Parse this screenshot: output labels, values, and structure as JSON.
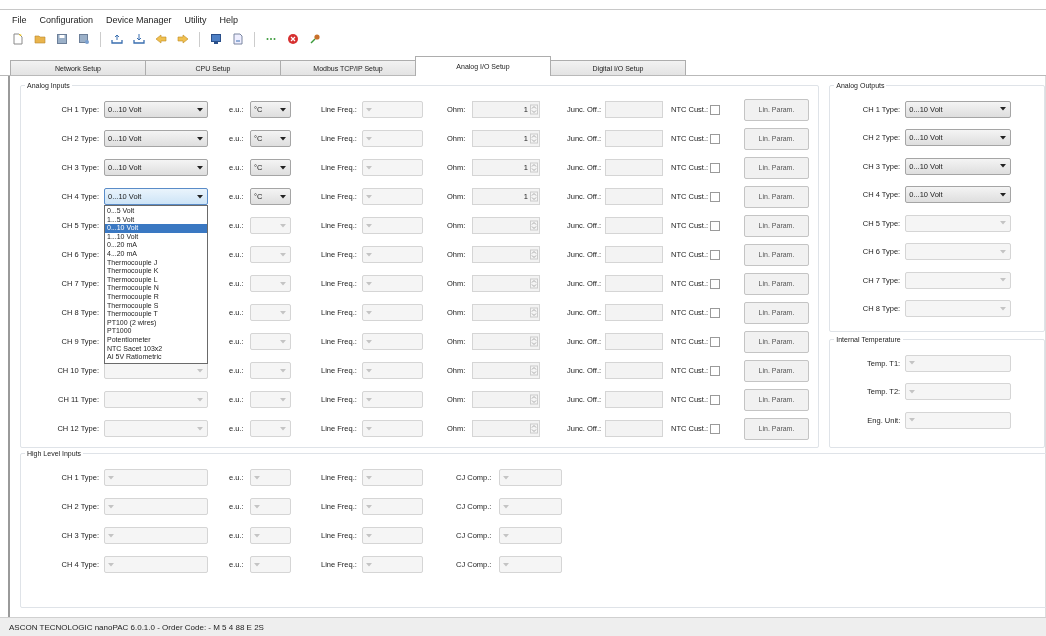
{
  "menu": [
    "File",
    "Configuration",
    "Device Manager",
    "Utility",
    "Help"
  ],
  "tabs": [
    {
      "label": "Network Setup",
      "selected": false
    },
    {
      "label": "CPU Setup",
      "selected": false
    },
    {
      "label": "Modbus TCP/IP Setup",
      "selected": false
    },
    {
      "label": "Analog I/O Setup",
      "selected": true
    },
    {
      "label": "Digital I/O Setup",
      "selected": false
    }
  ],
  "analog_inputs": {
    "title": "Analog Inputs",
    "rows": [
      {
        "label": "CH 1 Type:",
        "type": "0...10 Volt",
        "eu_label": "e.u.:",
        "eu": "°C",
        "freq_label": "Line Freq.:",
        "ohm_label": "Ohm:",
        "ohm": "1",
        "junc_label": "Junc. Off.:",
        "ntc_label": "NTC Cust.:",
        "ntc_checked": false,
        "button": "Lin. Param.",
        "enabled": true,
        "expanded": false
      },
      {
        "label": "CH 2 Type:",
        "type": "0...10 Volt",
        "eu_label": "e.u.:",
        "eu": "°C",
        "freq_label": "Line Freq.:",
        "ohm_label": "Ohm:",
        "ohm": "1",
        "junc_label": "Junc. Off.:",
        "ntc_label": "NTC Cust.:",
        "ntc_checked": false,
        "button": "Lin. Param.",
        "enabled": true,
        "expanded": false
      },
      {
        "label": "CH 3 Type:",
        "type": "0...10 Volt",
        "eu_label": "e.u.:",
        "eu": "°C",
        "freq_label": "Line Freq.:",
        "ohm_label": "Ohm:",
        "ohm": "1",
        "junc_label": "Junc. Off.:",
        "ntc_label": "NTC Cust.:",
        "ntc_checked": false,
        "button": "Lin. Param.",
        "enabled": true,
        "expanded": false
      },
      {
        "label": "CH 4 Type:",
        "type": "0...10 Volt",
        "eu_label": "e.u.:",
        "eu": "°C",
        "freq_label": "Line Freq.:",
        "ohm_label": "Ohm:",
        "ohm": "1",
        "junc_label": "Junc. Off.:",
        "ntc_label": "NTC Cust.:",
        "ntc_checked": false,
        "button": "Lin. Param.",
        "enabled": true,
        "expanded": true,
        "options": [
          {
            "label": "0...5 Volt",
            "selected": false
          },
          {
            "label": "1...5 Volt",
            "selected": false
          },
          {
            "label": "0...10 Volt",
            "selected": true
          },
          {
            "label": "1...10 Volt",
            "selected": false
          },
          {
            "label": "0...20 mA",
            "selected": false
          },
          {
            "label": "4...20 mA",
            "selected": false
          },
          {
            "label": "Thermocouple J",
            "selected": false
          },
          {
            "label": "Thermocouple K",
            "selected": false
          },
          {
            "label": "Thermocouple L",
            "selected": false
          },
          {
            "label": "Thermocouple N",
            "selected": false
          },
          {
            "label": "Thermocouple R",
            "selected": false
          },
          {
            "label": "Thermocouple S",
            "selected": false
          },
          {
            "label": "Thermocouple T",
            "selected": false
          },
          {
            "label": "PT100 (2 wires)",
            "selected": false
          },
          {
            "label": "PT1000",
            "selected": false
          },
          {
            "label": "Potentiometer",
            "selected": false
          },
          {
            "label": "NTC Sacet 103x2",
            "selected": false
          },
          {
            "label": "AI 5V Ratiometric",
            "selected": false
          }
        ]
      },
      {
        "label": "CH 5 Type:",
        "eu_label": "e.u.:",
        "freq_label": "Line Freq.:",
        "ohm_label": "Ohm:",
        "junc_label": "Junc. Off.:",
        "ntc_label": "NTC Cust.:",
        "ntc_checked": false,
        "button": "Lin. Param.",
        "enabled": false,
        "expanded": false
      },
      {
        "label": "CH 6 Type:",
        "eu_label": "e.u.:",
        "freq_label": "Line Freq.:",
        "ohm_label": "Ohm:",
        "junc_label": "Junc. Off.:",
        "ntc_label": "NTC Cust.:",
        "ntc_checked": false,
        "button": "Lin. Param.",
        "enabled": false,
        "expanded": false
      },
      {
        "label": "CH 7 Type:",
        "eu_label": "e.u.:",
        "freq_label": "Line Freq.:",
        "ohm_label": "Ohm:",
        "junc_label": "Junc. Off.:",
        "ntc_label": "NTC Cust.:",
        "ntc_checked": false,
        "button": "Lin. Param.",
        "enabled": false,
        "expanded": false
      },
      {
        "label": "CH 8 Type:",
        "eu_label": "e.u.:",
        "freq_label": "Line Freq.:",
        "ohm_label": "Ohm:",
        "junc_label": "Junc. Off.:",
        "ntc_label": "NTC Cust.:",
        "ntc_checked": false,
        "button": "Lin. Param.",
        "enabled": false,
        "expanded": false
      },
      {
        "label": "CH 9 Type:",
        "eu_label": "e.u.:",
        "freq_label": "Line Freq.:",
        "ohm_label": "Ohm:",
        "junc_label": "Junc. Off.:",
        "ntc_label": "NTC Cust.:",
        "ntc_checked": false,
        "button": "Lin. Param.",
        "enabled": false,
        "expanded": false
      },
      {
        "label": "CH 10 Type:",
        "eu_label": "e.u.:",
        "freq_label": "Line Freq.:",
        "ohm_label": "Ohm:",
        "junc_label": "Junc. Off.:",
        "ntc_label": "NTC Cust.:",
        "ntc_checked": false,
        "button": "Lin. Param.",
        "enabled": false,
        "expanded": false
      },
      {
        "label": "CH 11 Type:",
        "eu_label": "e.u.:",
        "freq_label": "Line Freq.:",
        "ohm_label": "Ohm:",
        "junc_label": "Junc. Off.:",
        "ntc_label": "NTC Cust.:",
        "ntc_checked": false,
        "button": "Lin. Param.",
        "enabled": false,
        "expanded": false
      },
      {
        "label": "CH 12 Type:",
        "eu_label": "e.u.:",
        "freq_label": "Line Freq.:",
        "ohm_label": "Ohm:",
        "junc_label": "Junc. Off.:",
        "ntc_label": "NTC Cust.:",
        "ntc_checked": false,
        "button": "Lin. Param.",
        "enabled": false,
        "expanded": false
      }
    ]
  },
  "analog_outputs": {
    "title": "Analog Outputs",
    "rows": [
      {
        "label": "CH 1 Type:",
        "type": "0...10 Volt",
        "enabled": true
      },
      {
        "label": "CH 2 Type:",
        "type": "0...10 Volt",
        "enabled": true
      },
      {
        "label": "CH 3 Type:",
        "type": "0...10 Volt",
        "enabled": true
      },
      {
        "label": "CH 4 Type:",
        "type": "0...10 Volt",
        "enabled": true
      },
      {
        "label": "CH 5 Type:",
        "enabled": false
      },
      {
        "label": "CH 6 Type:",
        "enabled": false
      },
      {
        "label": "CH 7 Type:",
        "enabled": false
      },
      {
        "label": "CH 8 Type:",
        "enabled": false
      }
    ]
  },
  "internal_temperature": {
    "title": "Internal Temperature",
    "rows": [
      {
        "label": "Temp. T1:",
        "enabled": false
      },
      {
        "label": "Temp. T2:",
        "enabled": false
      },
      {
        "label": "Eng. Unit:",
        "enabled": false
      }
    ]
  },
  "high_level_inputs": {
    "title": "High Level Inputs",
    "rows": [
      {
        "label": "CH 1 Type:",
        "eu_label": "e.u.:",
        "freq_label": "Line Freq.:",
        "cj_label": "CJ Comp.:",
        "enabled": false
      },
      {
        "label": "CH 2 Type:",
        "eu_label": "e.u.:",
        "freq_label": "Line Freq.:",
        "cj_label": "CJ Comp.:",
        "enabled": false
      },
      {
        "label": "CH 3 Type:",
        "eu_label": "e.u.:",
        "freq_label": "Line Freq.:",
        "cj_label": "CJ Comp.:",
        "enabled": false
      },
      {
        "label": "CH 4 Type:",
        "eu_label": "e.u.:",
        "freq_label": "Line Freq.:",
        "cj_label": "CJ Comp.:",
        "enabled": false
      }
    ]
  },
  "status_bar": "ASCON TECNOLOGIC nanoPAC 6.0.1.0 - Order Code: - M 5 4 88 E 2S"
}
